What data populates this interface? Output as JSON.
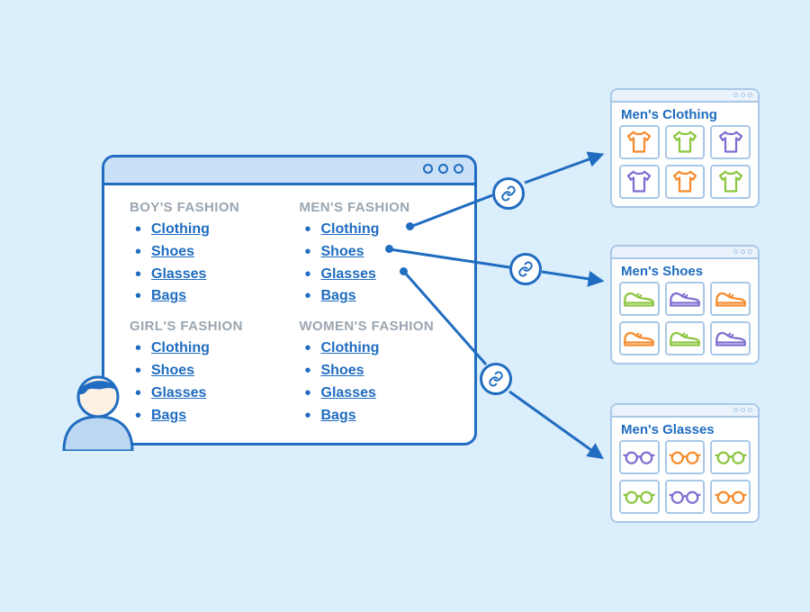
{
  "colors": {
    "orange": "#f58b2e",
    "green": "#8cc540",
    "purple": "#7d6fd0",
    "frame": "#1f6cc0",
    "tile_border": "#a9c8e8"
  },
  "main_window": {
    "categories": [
      {
        "key": "boys",
        "heading": "BOY'S FASHION",
        "links": [
          "Clothing",
          "Shoes",
          "Glasses",
          "Bags"
        ]
      },
      {
        "key": "mens",
        "heading": "MEN'S FASHION",
        "links": [
          "Clothing",
          "Shoes",
          "Glasses",
          "Bags"
        ]
      },
      {
        "key": "girls",
        "heading": "GIRL'S FASHION",
        "links": [
          "Clothing",
          "Shoes",
          "Glasses",
          "Bags"
        ]
      },
      {
        "key": "womens",
        "heading": "WOMEN'S FASHION",
        "links": [
          "Clothing",
          "Shoes",
          "Glasses",
          "Bags"
        ]
      }
    ]
  },
  "targets": [
    {
      "key": "clothing",
      "title": "Men's Clothing",
      "icon": "tshirt",
      "tile_colors": [
        "orange",
        "green",
        "purple",
        "purple",
        "orange",
        "green"
      ]
    },
    {
      "key": "shoes",
      "title": "Men's Shoes",
      "icon": "sneaker",
      "tile_colors": [
        "green",
        "purple",
        "orange",
        "orange",
        "green",
        "purple"
      ]
    },
    {
      "key": "glasses",
      "title": "Men's Glasses",
      "icon": "glasses",
      "tile_colors": [
        "purple",
        "orange",
        "green",
        "green",
        "purple",
        "orange"
      ]
    }
  ],
  "link_icon_name": "link-icon",
  "avatar_name": "user-avatar"
}
